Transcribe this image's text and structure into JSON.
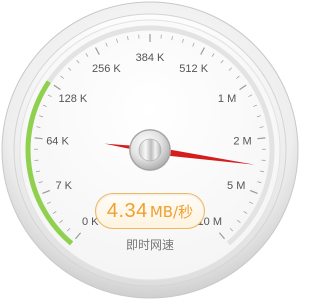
{
  "gauge": {
    "scale_labels": [
      "0 K",
      "7 K",
      "64 K",
      "128 K",
      "256 K",
      "384 K",
      "512 K",
      "1 M",
      "2 M",
      "5 M",
      "10 M"
    ],
    "current_value": "4.34",
    "current_unit": "MB/秒",
    "caption": "即时网速",
    "active_arc_fraction": 0.3,
    "needle_position_fraction": 0.85,
    "colors": {
      "active_arc": "#8fd14f",
      "needle": "#d61d1d",
      "readout_text": "#f0a030",
      "label_text": "#555555",
      "caption_text": "#777777",
      "tick": "#9a9a9a"
    }
  }
}
